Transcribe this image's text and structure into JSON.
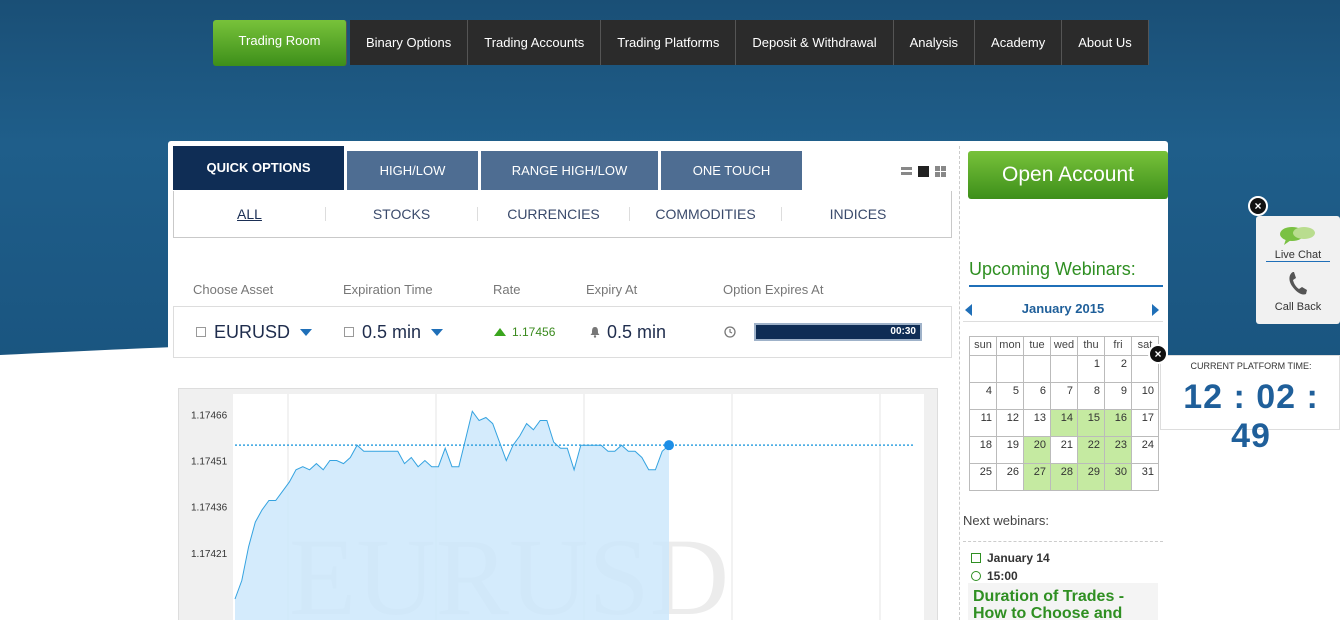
{
  "nav": {
    "items": [
      "Trading Room",
      "Binary Options",
      "Trading Accounts",
      "Trading Platforms",
      "Deposit & Withdrawal",
      "Analysis",
      "Academy",
      "About Us"
    ]
  },
  "tabs": [
    "QUICK OPTIONS",
    "HIGH/LOW",
    "RANGE HIGH/LOW",
    "ONE TOUCH"
  ],
  "filters": [
    "ALL",
    "STOCKS",
    "CURRENCIES",
    "COMMODITIES",
    "INDICES"
  ],
  "columns": {
    "asset": "Choose Asset",
    "expiration": "Expiration Time",
    "rate": "Rate",
    "expiry": "Expiry At",
    "option_expires": "Option Expires At"
  },
  "trade": {
    "asset": "EURUSD",
    "expiration": "0.5 min",
    "rate": "1.17456",
    "expiry": "0.5 min",
    "countdown": "00:30",
    "countdown_fraction": 1.0
  },
  "chart_data": {
    "type": "area",
    "watermark": "EURUSD",
    "y_ticks": [
      "1.17466",
      "1.17451",
      "1.17436",
      "1.17421"
    ],
    "ylim": [
      1.17406,
      1.17471
    ],
    "grid": true,
    "current_value": 1.17456,
    "values": [
      1.17406,
      1.17412,
      1.17423,
      1.17431,
      1.17435,
      1.17438,
      1.17438,
      1.17441,
      1.17444,
      1.17448,
      1.17449,
      1.17448,
      1.1745,
      1.17448,
      1.17451,
      1.17451,
      1.1745,
      1.17452,
      1.17456,
      1.17454,
      1.17454,
      1.17454,
      1.17454,
      1.17454,
      1.17454,
      1.1745,
      1.17452,
      1.17449,
      1.17451,
      1.17449,
      1.17449,
      1.17455,
      1.17449,
      1.17449,
      1.17458,
      1.17467,
      1.17464,
      1.17465,
      1.17463,
      1.17457,
      1.17451,
      1.17456,
      1.17459,
      1.17463,
      1.17461,
      1.17464,
      1.17464,
      1.17457,
      1.17455,
      1.17455,
      1.17448,
      1.17456,
      1.17456,
      1.17456,
      1.17456,
      1.17454,
      1.17454,
      1.17456,
      1.17454,
      1.17454,
      1.17452,
      1.17448,
      1.17448,
      1.17454,
      1.17456
    ]
  },
  "open_account": "Open Account",
  "webinars": {
    "title": "Upcoming Webinars:",
    "month": "January 2015",
    "weekdays": [
      "sun",
      "mon",
      "tue",
      "wed",
      "thu",
      "fri",
      "sat"
    ],
    "weeks": [
      [
        "",
        "",
        "",
        "",
        "1",
        "2",
        ""
      ],
      [
        "4",
        "5",
        "6",
        "7",
        "8",
        "9",
        "10"
      ],
      [
        "11",
        "12",
        "13",
        "14",
        "15",
        "16",
        "17"
      ],
      [
        "18",
        "19",
        "20",
        "21",
        "22",
        "23",
        "24"
      ],
      [
        "25",
        "26",
        "27",
        "28",
        "29",
        "30",
        "31"
      ]
    ],
    "highlighted": [
      "14",
      "15",
      "16",
      "20",
      "22",
      "23",
      "27",
      "28",
      "29",
      "30"
    ],
    "next_label": "Next webinars:",
    "next_date": "January 14",
    "next_time": "15:00",
    "next_title": "Duration of Trades - How to Choose and"
  },
  "side": {
    "live_chat": "Live Chat",
    "call_back": "Call Back"
  },
  "clock": {
    "label": "CURRENT PLATFORM TIME:",
    "time": "12 : 02 : 49"
  },
  "colors": {
    "nav_bg": "#2b2b2b",
    "green": "#3d8f1a",
    "tab_active": "#0f2d55",
    "tab": "#4e6d92",
    "chart_fill": "#cde8fb",
    "chart_line": "#35a3e0"
  }
}
